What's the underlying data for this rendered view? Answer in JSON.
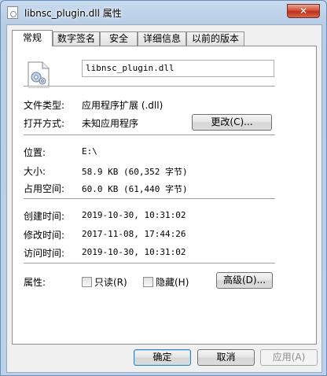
{
  "window": {
    "title": "libnsc_plugin.dll 属性",
    "close_glyph": "✕"
  },
  "tabs": [
    {
      "label": "常规",
      "active": true
    },
    {
      "label": "数字签名",
      "active": false
    },
    {
      "label": "安全",
      "active": false
    },
    {
      "label": "详细信息",
      "active": false
    },
    {
      "label": "以前的版本",
      "active": false
    }
  ],
  "general": {
    "file_name": "libnsc_plugin.dll",
    "file_type_label": "文件类型:",
    "file_type_value": "应用程序扩展 (.dll)",
    "opens_with_label": "打开方式:",
    "opens_with_value": "未知应用程序",
    "change_button": "更改(C)...",
    "location_label": "位置:",
    "location_value": "E:\\",
    "size_label": "大小:",
    "size_value": "58.9 KB (60,352 字节)",
    "size_on_disk_label": "占用空间:",
    "size_on_disk_value": "60.0 KB (61,440 字节)",
    "created_label": "创建时间:",
    "created_value": "2019-10-30, 10:31:02",
    "modified_label": "修改时间:",
    "modified_value": "2017-11-08, 17:44:26",
    "accessed_label": "访问时间:",
    "accessed_value": "2019-10-30, 10:31:02",
    "attributes_label": "属性:",
    "readonly_label": "只读(R)",
    "readonly_checked": false,
    "hidden_label": "隐藏(H)",
    "hidden_checked": false,
    "advanced_button": "高级(D)..."
  },
  "footer": {
    "ok": "确定",
    "cancel": "取消",
    "apply": "应用(A)"
  },
  "colors": {
    "accent": "#3c7fb1",
    "close": "#c1301a"
  }
}
